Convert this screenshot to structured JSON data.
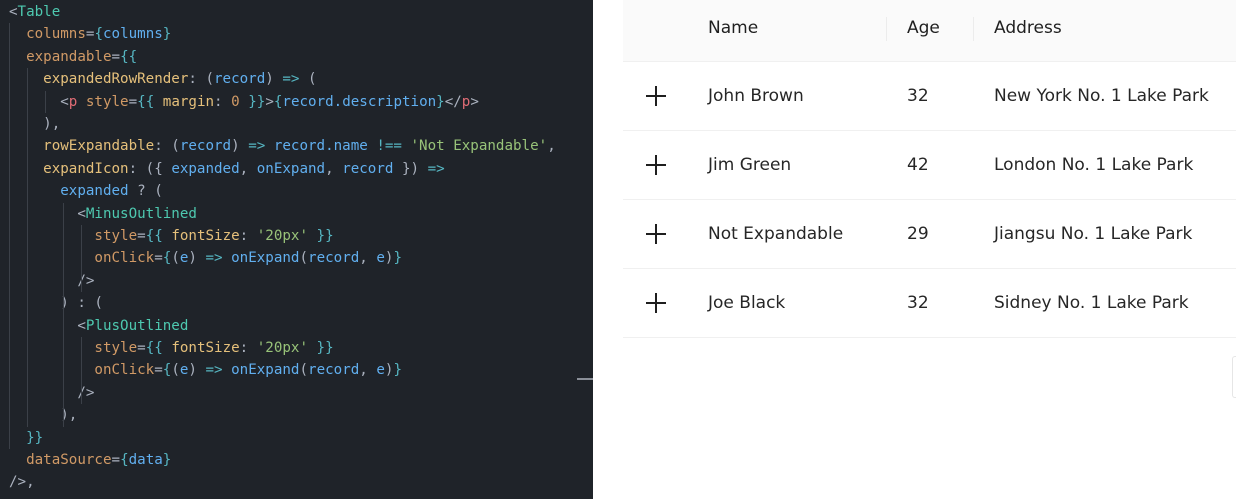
{
  "code": {
    "lines": [
      [
        {
          "t": "<",
          "c": "punc"
        },
        {
          "t": "Table",
          "c": "comp"
        }
      ],
      [
        {
          "t": "  "
        },
        {
          "t": "columns",
          "c": "attr"
        },
        {
          "t": "=",
          "c": "punc"
        },
        {
          "t": "{",
          "c": "brace"
        },
        {
          "t": "columns",
          "c": "var"
        },
        {
          "t": "}",
          "c": "brace"
        }
      ],
      [
        {
          "t": "  "
        },
        {
          "t": "expandable",
          "c": "attr"
        },
        {
          "t": "=",
          "c": "punc"
        },
        {
          "t": "{{",
          "c": "brace"
        }
      ],
      [
        {
          "t": "    "
        },
        {
          "t": "expandedRowRender",
          "c": "prop"
        },
        {
          "t": ": (",
          "c": "punc"
        },
        {
          "t": "record",
          "c": "var"
        },
        {
          "t": ") ",
          "c": "punc"
        },
        {
          "t": "=>",
          "c": "op"
        },
        {
          "t": " (",
          "c": "punc"
        }
      ],
      [
        {
          "t": "      "
        },
        {
          "t": "<",
          "c": "punc"
        },
        {
          "t": "p",
          "c": "tag"
        },
        {
          "t": " "
        },
        {
          "t": "style",
          "c": "attr"
        },
        {
          "t": "=",
          "c": "punc"
        },
        {
          "t": "{{",
          "c": "brace"
        },
        {
          "t": " margin",
          "c": "prop"
        },
        {
          "t": ": ",
          "c": "punc"
        },
        {
          "t": "0",
          "c": "num"
        },
        {
          "t": " }}",
          "c": "brace"
        },
        {
          "t": ">",
          "c": "punc"
        },
        {
          "t": "{",
          "c": "brace"
        },
        {
          "t": "record.description",
          "c": "var"
        },
        {
          "t": "}",
          "c": "brace"
        },
        {
          "t": "</",
          "c": "punc"
        },
        {
          "t": "p",
          "c": "tag"
        },
        {
          "t": ">",
          "c": "punc"
        }
      ],
      [
        {
          "t": "    ),",
          "c": "punc"
        }
      ],
      [
        {
          "t": "    "
        },
        {
          "t": "rowExpandable",
          "c": "prop"
        },
        {
          "t": ": (",
          "c": "punc"
        },
        {
          "t": "record",
          "c": "var"
        },
        {
          "t": ") ",
          "c": "punc"
        },
        {
          "t": "=>",
          "c": "op"
        },
        {
          "t": " "
        },
        {
          "t": "record.name",
          "c": "var"
        },
        {
          "t": " "
        },
        {
          "t": "!==",
          "c": "op"
        },
        {
          "t": " "
        },
        {
          "t": "'Not Expandable'",
          "c": "str"
        },
        {
          "t": ",",
          "c": "punc"
        }
      ],
      [
        {
          "t": "    "
        },
        {
          "t": "expandIcon",
          "c": "prop"
        },
        {
          "t": ": ({ ",
          "c": "punc"
        },
        {
          "t": "expanded",
          "c": "var"
        },
        {
          "t": ", ",
          "c": "punc"
        },
        {
          "t": "onExpand",
          "c": "var"
        },
        {
          "t": ", ",
          "c": "punc"
        },
        {
          "t": "record",
          "c": "var"
        },
        {
          "t": " }) ",
          "c": "punc"
        },
        {
          "t": "=>",
          "c": "op"
        }
      ],
      [
        {
          "t": "      "
        },
        {
          "t": "expanded",
          "c": "var"
        },
        {
          "t": " ? (",
          "c": "punc"
        }
      ],
      [
        {
          "t": "        "
        },
        {
          "t": "<",
          "c": "punc"
        },
        {
          "t": "MinusOutlined",
          "c": "comp"
        }
      ],
      [
        {
          "t": "          "
        },
        {
          "t": "style",
          "c": "attr"
        },
        {
          "t": "=",
          "c": "punc"
        },
        {
          "t": "{{",
          "c": "brace"
        },
        {
          "t": " fontSize",
          "c": "prop"
        },
        {
          "t": ": ",
          "c": "punc"
        },
        {
          "t": "'20px'",
          "c": "str"
        },
        {
          "t": " }}",
          "c": "brace"
        }
      ],
      [
        {
          "t": "          "
        },
        {
          "t": "onClick",
          "c": "attr"
        },
        {
          "t": "=",
          "c": "punc"
        },
        {
          "t": "{",
          "c": "brace"
        },
        {
          "t": "(",
          "c": "punc"
        },
        {
          "t": "e",
          "c": "var"
        },
        {
          "t": ") ",
          "c": "punc"
        },
        {
          "t": "=>",
          "c": "op"
        },
        {
          "t": " "
        },
        {
          "t": "onExpand",
          "c": "fn"
        },
        {
          "t": "(",
          "c": "punc"
        },
        {
          "t": "record",
          "c": "var"
        },
        {
          "t": ", ",
          "c": "punc"
        },
        {
          "t": "e",
          "c": "var"
        },
        {
          "t": ")",
          "c": "punc"
        },
        {
          "t": "}",
          "c": "brace"
        }
      ],
      [
        {
          "t": "        "
        },
        {
          "t": "/>",
          "c": "punc"
        }
      ],
      [
        {
          "t": "      ) : (",
          "c": "punc"
        }
      ],
      [
        {
          "t": "        "
        },
        {
          "t": "<",
          "c": "punc"
        },
        {
          "t": "PlusOutlined",
          "c": "comp"
        }
      ],
      [
        {
          "t": "          "
        },
        {
          "t": "style",
          "c": "attr"
        },
        {
          "t": "=",
          "c": "punc"
        },
        {
          "t": "{{",
          "c": "brace"
        },
        {
          "t": " fontSize",
          "c": "prop"
        },
        {
          "t": ": ",
          "c": "punc"
        },
        {
          "t": "'20px'",
          "c": "str"
        },
        {
          "t": " }}",
          "c": "brace"
        }
      ],
      [
        {
          "t": "          "
        },
        {
          "t": "onClick",
          "c": "attr"
        },
        {
          "t": "=",
          "c": "punc"
        },
        {
          "t": "{",
          "c": "brace"
        },
        {
          "t": "(",
          "c": "punc"
        },
        {
          "t": "e",
          "c": "var"
        },
        {
          "t": ") ",
          "c": "punc"
        },
        {
          "t": "=>",
          "c": "op"
        },
        {
          "t": " "
        },
        {
          "t": "onExpand",
          "c": "fn"
        },
        {
          "t": "(",
          "c": "punc"
        },
        {
          "t": "record",
          "c": "var"
        },
        {
          "t": ", ",
          "c": "punc"
        },
        {
          "t": "e",
          "c": "var"
        },
        {
          "t": ")",
          "c": "punc"
        },
        {
          "t": "}",
          "c": "brace"
        }
      ],
      [
        {
          "t": "        "
        },
        {
          "t": "/>",
          "c": "punc"
        }
      ],
      [
        {
          "t": "      ),",
          "c": "punc"
        }
      ],
      [
        {
          "t": "  "
        },
        {
          "t": "}}",
          "c": "brace"
        }
      ],
      [
        {
          "t": "  "
        },
        {
          "t": "dataSource",
          "c": "attr"
        },
        {
          "t": "=",
          "c": "punc"
        },
        {
          "t": "{",
          "c": "brace"
        },
        {
          "t": "data",
          "c": "var"
        },
        {
          "t": "}",
          "c": "brace"
        }
      ],
      [
        {
          "t": "/>,",
          "c": "punc"
        }
      ]
    ]
  },
  "table": {
    "columns": [
      "Name",
      "Age",
      "Address"
    ],
    "expand_icon": "plus-icon",
    "rows": [
      {
        "name": "John Brown",
        "age": "32",
        "address": "New York No. 1 Lake Park"
      },
      {
        "name": "Jim Green",
        "age": "42",
        "address": "London No. 1 Lake Park"
      },
      {
        "name": "Not Expandable",
        "age": "29",
        "address": "Jiangsu No. 1 Lake Park"
      },
      {
        "name": "Joe Black",
        "age": "32",
        "address": "Sidney No. 1 Lake Park"
      }
    ]
  },
  "colors": {
    "editor_background": "#1f2329",
    "table_header_background": "#fafafa",
    "row_divider": "#f0f0f0"
  }
}
